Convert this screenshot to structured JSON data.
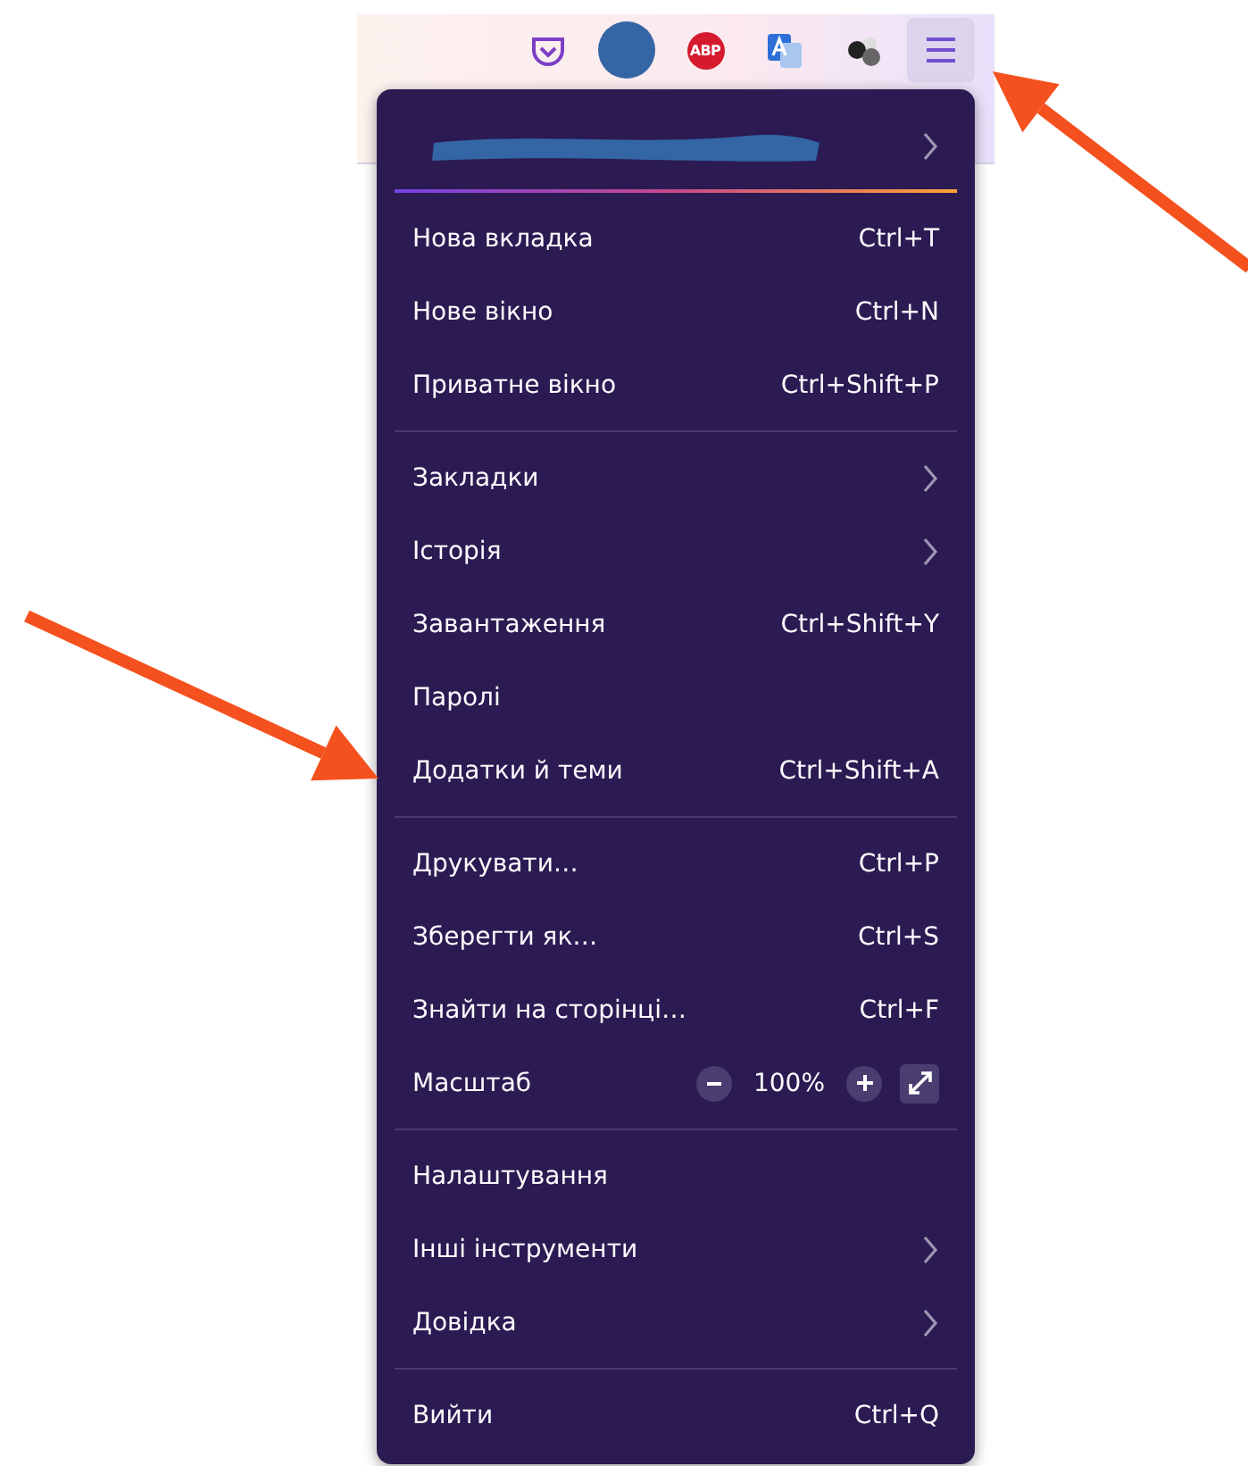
{
  "toolbar": {
    "buttons": [
      {
        "kind": "pocket"
      },
      {
        "kind": "avatar"
      },
      {
        "kind": "abp",
        "label": "ABP"
      },
      {
        "kind": "translate"
      },
      {
        "kind": "molecule"
      },
      {
        "kind": "menu",
        "selected": true
      }
    ]
  },
  "menu": {
    "account": {
      "redacted": true
    },
    "sections": [
      {
        "items": [
          {
            "kind": "item",
            "label": "Нова вкладка",
            "shortcut": "Ctrl+T",
            "submenu": false
          },
          {
            "kind": "item",
            "label": "Нове вікно",
            "shortcut": "Ctrl+N",
            "submenu": false
          },
          {
            "kind": "item",
            "label": "Приватне вікно",
            "shortcut": "Ctrl+Shift+P",
            "submenu": false
          }
        ]
      },
      {
        "items": [
          {
            "kind": "item",
            "label": "Закладки",
            "submenu": true
          },
          {
            "kind": "item",
            "label": "Історія",
            "submenu": true
          },
          {
            "kind": "item",
            "label": "Завантаження",
            "shortcut": "Ctrl+Shift+Y",
            "submenu": false
          },
          {
            "kind": "item",
            "label": "Паролі",
            "submenu": false
          },
          {
            "kind": "item",
            "label": "Додатки й теми",
            "shortcut": "Ctrl+Shift+A",
            "submenu": false
          }
        ]
      },
      {
        "items": [
          {
            "kind": "item",
            "label": "Друкувати…",
            "shortcut": "Ctrl+P",
            "submenu": false
          },
          {
            "kind": "item",
            "label": "Зберегти як…",
            "shortcut": "Ctrl+S",
            "submenu": false
          },
          {
            "kind": "item",
            "label": "Знайти на сторінці…",
            "shortcut": "Ctrl+F",
            "submenu": false
          },
          {
            "kind": "zoom",
            "label": "Масштаб",
            "value": "100%"
          }
        ]
      },
      {
        "items": [
          {
            "kind": "item",
            "label": "Налаштування",
            "submenu": false
          },
          {
            "kind": "item",
            "label": "Інші інструменти",
            "submenu": true
          },
          {
            "kind": "item",
            "label": "Довідка",
            "submenu": true
          }
        ]
      },
      {
        "items": [
          {
            "kind": "item",
            "label": "Вийти",
            "shortcut": "Ctrl+Q",
            "submenu": false
          }
        ]
      }
    ]
  },
  "annotations": [
    {
      "kind": "arrow"
    },
    {
      "kind": "arrow"
    }
  ]
}
